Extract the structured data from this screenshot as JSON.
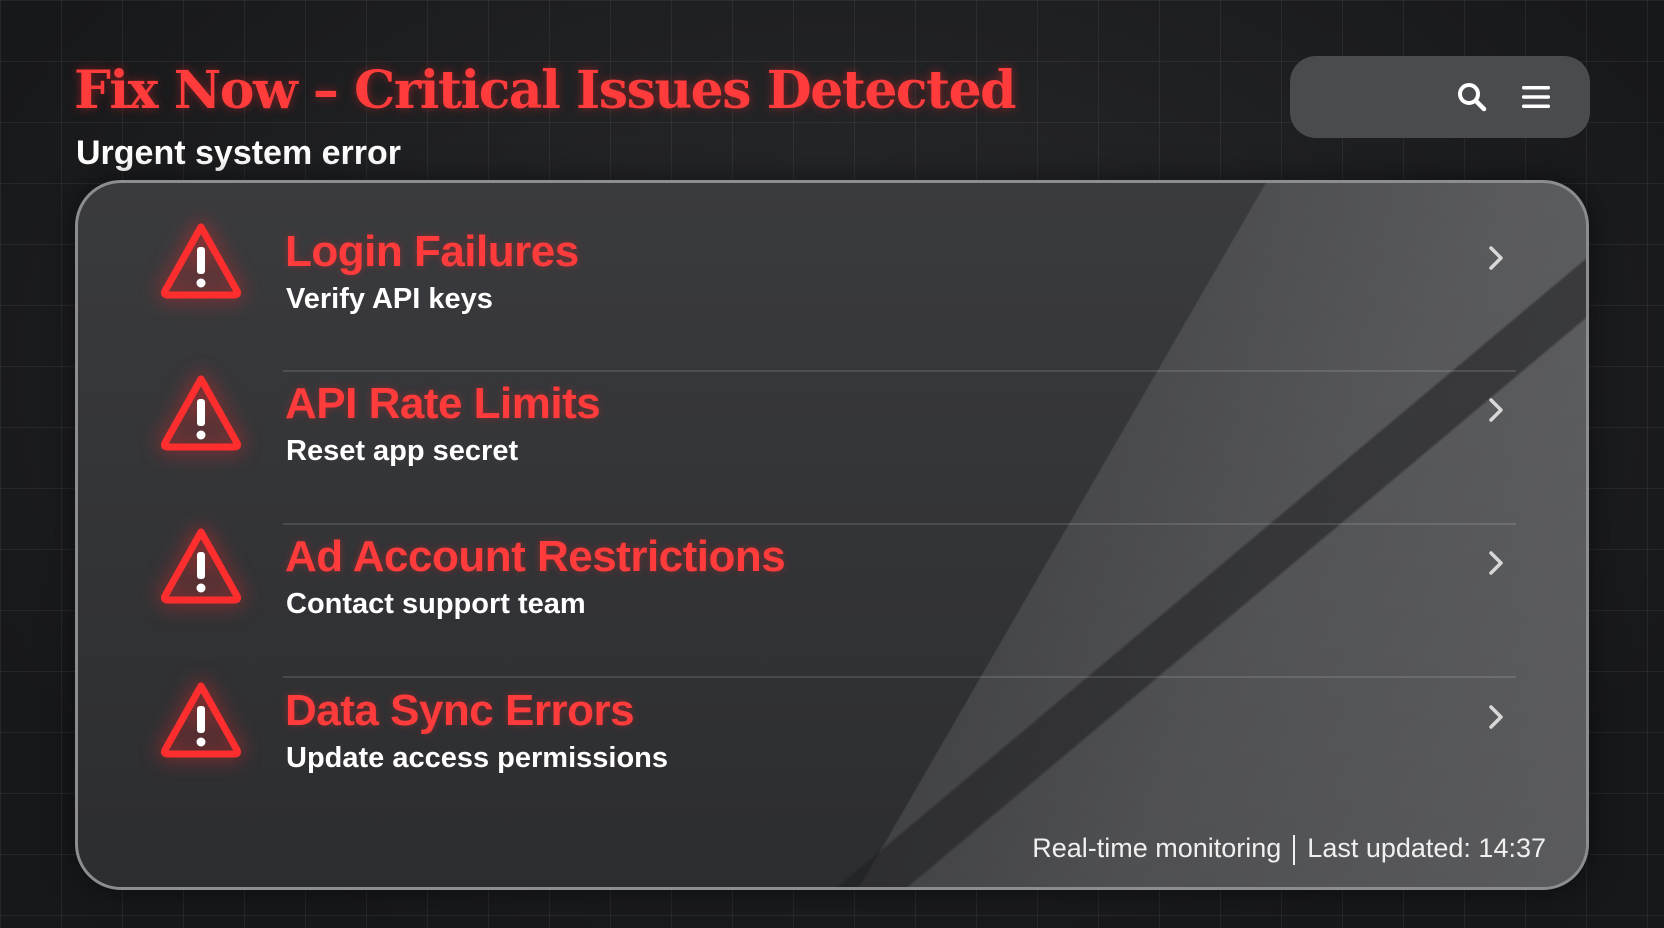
{
  "header": {
    "title": "Fix Now – Critical Issues Detected",
    "subtitle": "Urgent system error"
  },
  "topbar": {
    "icons": [
      "search-icon",
      "hamburger-menu-icon"
    ]
  },
  "issues": [
    {
      "title": "Login Failures",
      "description": "Verify API keys",
      "icon": "warning-triangle-icon"
    },
    {
      "title": "API Rate Limits",
      "description": "Reset app secret",
      "icon": "warning-triangle-icon"
    },
    {
      "title": "Ad Account Restrictions",
      "description": "Contact support team",
      "icon": "warning-triangle-icon"
    },
    {
      "title": "Data Sync Errors",
      "description": "Update access permissions",
      "icon": "warning-triangle-icon"
    }
  ],
  "footer": {
    "monitoring": "Real-time monitoring",
    "last_updated": "Last updated: 14:37"
  },
  "colors": {
    "accent_red": "#ff3b3b",
    "background": "#1c1d1f",
    "panel": "#333437",
    "topbar": "#4a4b4e"
  }
}
